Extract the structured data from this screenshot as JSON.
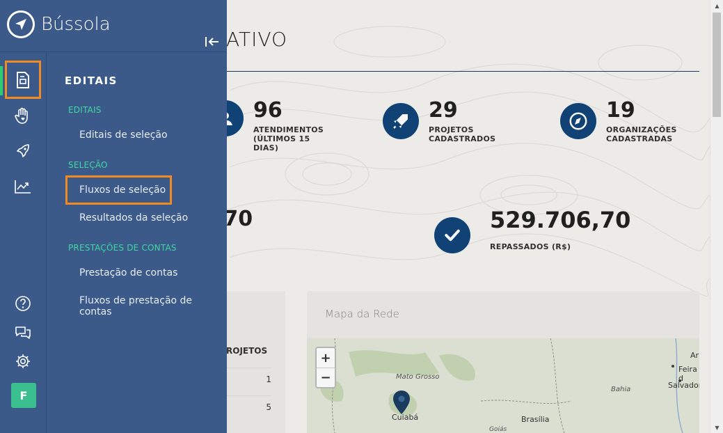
{
  "brand": {
    "name": "Bússola"
  },
  "dashboard": {
    "title_partial": "ATIVO",
    "stats": [
      {
        "value": "96",
        "label_lines": [
          "ATENDIMENTOS",
          "(ÚLTIMOS 15",
          "DIAS)"
        ]
      },
      {
        "value": "29",
        "label_lines": [
          "PROJETOS",
          "CADASTRADOS"
        ]
      },
      {
        "value": "19",
        "label_lines": [
          "ORGANIZAÇÕES",
          "CADASTRADAS"
        ]
      },
      {
        "value": ",70",
        "label_lines": []
      },
      {
        "value": "529.706,70",
        "label_lines": [
          "REPASSADOS (R$)"
        ]
      }
    ],
    "table": {
      "header": "ROJETOS",
      "values": [
        "1",
        "5"
      ]
    },
    "map": {
      "title": "Mapa da Rede",
      "zoom_in": "+",
      "zoom_out": "−",
      "labels": [
        "Mato Grosso",
        "Bahia",
        "Goiás"
      ],
      "cities": [
        "Cuiabá",
        "Brasília",
        "Salvador",
        "Feira d",
        "Ar"
      ]
    }
  },
  "sidebar": {
    "menu_title": "EDITAIS",
    "sections": [
      {
        "title": "EDITAIS",
        "items": [
          "Editais de seleção"
        ]
      },
      {
        "title": "SELEÇÃO",
        "items": [
          "Fluxos de seleção",
          "Resultados da seleção"
        ]
      },
      {
        "title": "PRESTAÇÕES DE CONTAS",
        "items": [
          "Prestação de contas",
          "Fluxos de prestação de contas"
        ]
      }
    ],
    "rail_icons": [
      "editais-icon",
      "hand-heart-icon",
      "rocket-icon",
      "chart-line-icon",
      "help-icon",
      "chat-icon",
      "gear-icon"
    ],
    "avatar_initial": "F"
  },
  "colors": {
    "sidebar_bg": "#3b5a89",
    "section_accent": "#3fd8a0",
    "active_bar": "#2ecc71",
    "highlight": "#f28a22",
    "stat_icon_bg": "#12457a",
    "avatar_bg": "#3cbf8f"
  }
}
